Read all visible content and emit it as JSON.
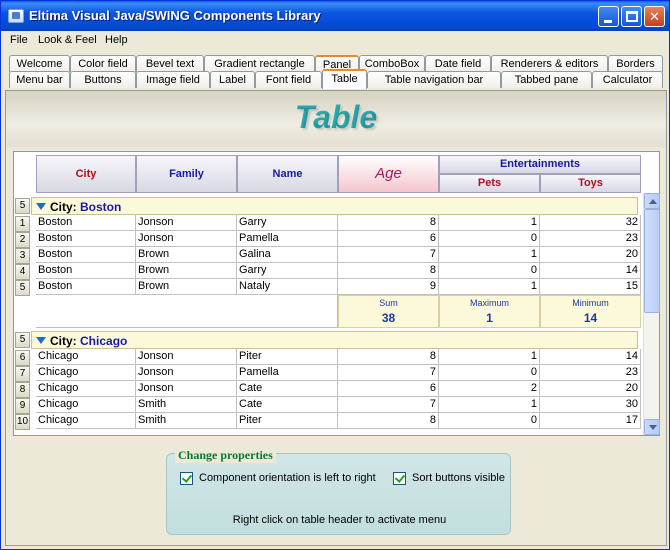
{
  "window": {
    "title": "Eltima Visual Java/SWING Components Library"
  },
  "menu": [
    "File",
    "Look & Feel",
    "Help"
  ],
  "tabs_row1": [
    "Welcome",
    "Color field",
    "Bevel text",
    "Gradient rectangle",
    "Panel",
    "ComboBox",
    "Date field",
    "Renderers & editors",
    "Borders"
  ],
  "tabs_row2": [
    "Menu bar",
    "Buttons",
    "Image field",
    "Label",
    "Font field",
    "Table",
    "Table navigation bar",
    "Tabbed pane",
    "Calculator"
  ],
  "banner": {
    "title": "Table"
  },
  "table": {
    "headers": {
      "city": "City",
      "family": "Family",
      "name": "Name",
      "age": "Age",
      "entertainments": "Entertainments",
      "pets": "Pets",
      "toys": "Toys"
    },
    "groups": [
      {
        "count": "5",
        "label": "City:",
        "value": "Boston",
        "rows": [
          {
            "num": "1",
            "city": "Boston",
            "family": "Jonson",
            "name": "Garry",
            "age": "8",
            "pets": "1",
            "toys": "32"
          },
          {
            "num": "2",
            "city": "Boston",
            "family": "Jonson",
            "name": "Pamella",
            "age": "6",
            "pets": "0",
            "toys": "23"
          },
          {
            "num": "3",
            "city": "Boston",
            "family": "Brown",
            "name": "Galina",
            "age": "7",
            "pets": "1",
            "toys": "20"
          },
          {
            "num": "4",
            "city": "Boston",
            "family": "Brown",
            "name": "Garry",
            "age": "8",
            "pets": "0",
            "toys": "14"
          },
          {
            "num": "5",
            "city": "Boston",
            "family": "Brown",
            "name": "Nataly",
            "age": "9",
            "pets": "1",
            "toys": "15"
          }
        ],
        "summary": {
          "sum_label": "Sum",
          "sum_value": "38",
          "max_label": "Maximum",
          "max_value": "1",
          "min_label": "Minimum",
          "min_value": "14"
        }
      },
      {
        "count": "5",
        "label": "City:",
        "value": "Chicago",
        "rows": [
          {
            "num": "6",
            "city": "Chicago",
            "family": "Jonson",
            "name": "Piter",
            "age": "8",
            "pets": "1",
            "toys": "14"
          },
          {
            "num": "7",
            "city": "Chicago",
            "family": "Jonson",
            "name": "Pamella",
            "age": "7",
            "pets": "0",
            "toys": "23"
          },
          {
            "num": "8",
            "city": "Chicago",
            "family": "Jonson",
            "name": "Cate",
            "age": "6",
            "pets": "2",
            "toys": "20"
          },
          {
            "num": "9",
            "city": "Chicago",
            "family": "Smith",
            "name": "Cate",
            "age": "7",
            "pets": "1",
            "toys": "30"
          },
          {
            "num": "10",
            "city": "Chicago",
            "family": "Smith",
            "name": "Piter",
            "age": "8",
            "pets": "0",
            "toys": "17"
          }
        ]
      }
    ]
  },
  "properties": {
    "title": "Change properties",
    "orientation_label": "Component orientation is left to right",
    "sort_label": "Sort buttons visible",
    "hint": "Right click on table header to activate menu"
  }
}
